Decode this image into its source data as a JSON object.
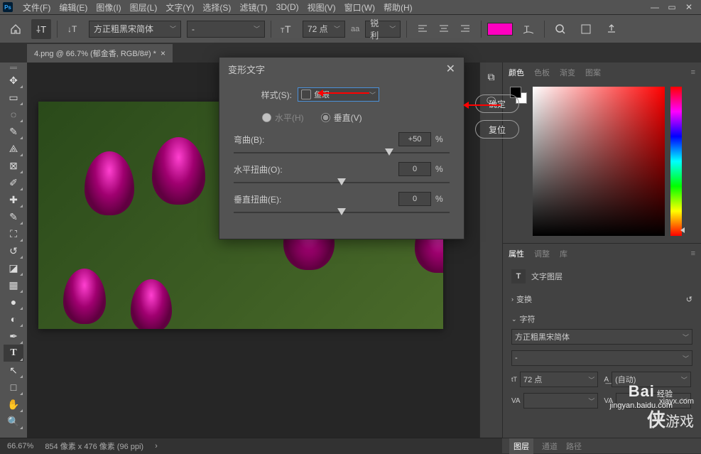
{
  "menubar": [
    "文件(F)",
    "编辑(E)",
    "图像(I)",
    "图层(L)",
    "文字(Y)",
    "选择(S)",
    "滤镜(T)",
    "3D(D)",
    "视图(V)",
    "窗口(W)",
    "帮助(H)"
  ],
  "optbar": {
    "font": "方正粗黑宋简体",
    "style": "-",
    "size_icon": "tT",
    "size": "72 点",
    "aa_label": "aa",
    "aa": "锐利",
    "swatch": "#ff00c0"
  },
  "tab": {
    "label": "4.png @ 66.7% (郁金香, RGB/8#) *"
  },
  "dialog": {
    "title": "变形文字",
    "style_label": "样式(S):",
    "style_value": "鱼眼",
    "horiz": "水平(H)",
    "vert": "垂直(V)",
    "bend_label": "弯曲(B):",
    "bend_value": "+50",
    "hdist_label": "水平扭曲(O):",
    "hdist_value": "0",
    "vdist_label": "垂直扭曲(E):",
    "vdist_value": "0",
    "pct": "%",
    "ok": "确定",
    "reset": "复位"
  },
  "panels": {
    "color_tabs": [
      "颜色",
      "色板",
      "渐变",
      "图案"
    ],
    "props_tabs": [
      "属性",
      "调整",
      "库"
    ],
    "layer_type": "文字图层",
    "transform": "变换",
    "character": "字符",
    "font": "方正粗黑宋简体",
    "style": "-",
    "size": "72 点",
    "leading": "(自动)",
    "tracking": "VA",
    "kerning": "VA",
    "bottom_tabs": [
      "图层",
      "通道",
      "路径"
    ]
  },
  "status": {
    "zoom": "66.67%",
    "info": "854 像素 x 476 像素 (96 ppi)"
  },
  "watermark1": {
    "brand": "Bai",
    "sub": "经验",
    "url": "jingyan.baidu.com"
  },
  "watermark2": {
    "brand": "侠",
    "sub": "游戏",
    "url": "xiayx.com"
  }
}
